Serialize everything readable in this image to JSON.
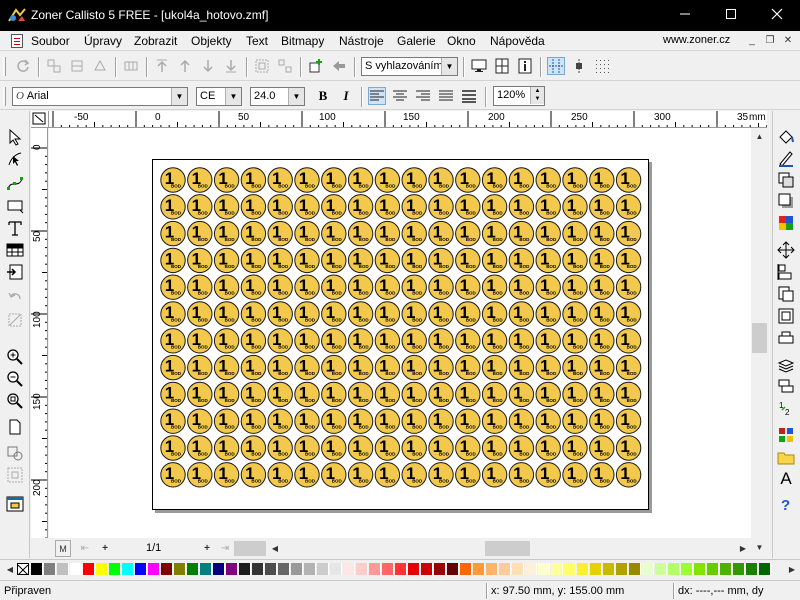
{
  "window": {
    "title": "Zoner Callisto 5 FREE - [ukol4a_hotovo.zmf]",
    "controls": [
      "minimize",
      "maximize",
      "close"
    ]
  },
  "menubar": {
    "items": [
      "Soubor",
      "Úpravy",
      "Zobrazit",
      "Objekty",
      "Text",
      "Bitmapy",
      "Nástroje",
      "Galerie",
      "Okno",
      "Nápověda"
    ],
    "site": "www.zoner.cz"
  },
  "toolbar1": {
    "antialias_select": "S vyhlazováním"
  },
  "toolbar2": {
    "font_name": "Arial",
    "charset": "CE",
    "font_size": "24.0",
    "bold": "B",
    "italic": "I",
    "zoom": "120%"
  },
  "ruler": {
    "unit": "mm",
    "h_labels": [
      "-50",
      "0",
      "50",
      "100",
      "150",
      "200",
      "250",
      "300",
      "35"
    ],
    "v_labels": [
      "0",
      "50",
      "100",
      "150",
      "200"
    ]
  },
  "coin": {
    "digit": "1",
    "label": "BOD",
    "columns": 18,
    "rows": 12,
    "fill": "#f2c94c",
    "stroke": "#1a1a1a"
  },
  "pagenav": {
    "page_indicator": "1/1",
    "first_label": "M",
    "add_label": "+"
  },
  "statusbar": {
    "status": "Připraven",
    "coordinates": "x: 97.50 mm, y: 155.00 mm",
    "delta": "dx: ----,--- mm, dy"
  },
  "palette": {
    "colors": [
      "#000000",
      "#808080",
      "#c0c0c0",
      "#ffffff",
      "#ff0000",
      "#ffff00",
      "#00ff00",
      "#00ffff",
      "#0000ff",
      "#ff00ff",
      "#800000",
      "#808000",
      "#008000",
      "#008080",
      "#000080",
      "#800080",
      "#1a1a1a",
      "#333333",
      "#4d4d4d",
      "#666666",
      "#999999",
      "#b3b3b3",
      "#cccccc",
      "#e6e6e6",
      "#ffe6e6",
      "#ffcccc",
      "#ff9999",
      "#ff6666",
      "#ff3333",
      "#e60000",
      "#cc0000",
      "#990000",
      "#660000",
      "#ff6600",
      "#ff9933",
      "#ffb366",
      "#ffcc99",
      "#ffe0b3",
      "#fff0d9",
      "#ffffcc",
      "#ffff99",
      "#ffff66",
      "#ffee33",
      "#e6d000",
      "#ccb800",
      "#b3a000",
      "#998800",
      "#e6ffcc",
      "#ccff99",
      "#b3ff66",
      "#99ff33",
      "#80e600",
      "#66cc00",
      "#4db300",
      "#339900",
      "#1a8000",
      "#006600"
    ]
  }
}
